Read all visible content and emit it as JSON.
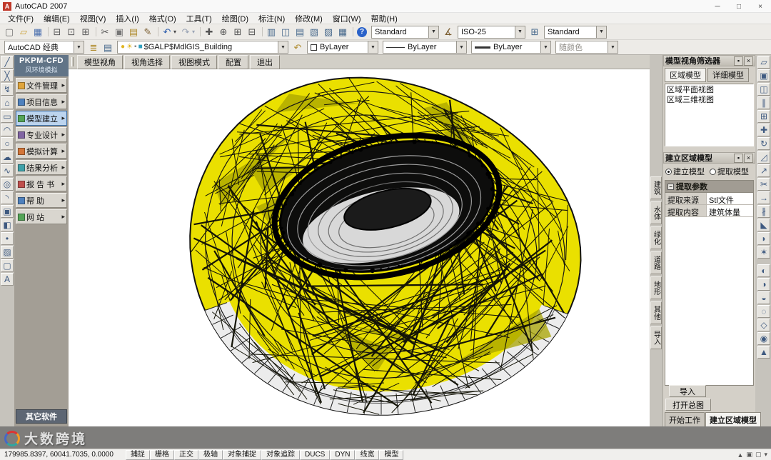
{
  "window": {
    "title": "AutoCAD 2007",
    "controls": [
      {
        "n": "minimize-button",
        "g": "─"
      },
      {
        "n": "maximize-button",
        "g": "□"
      },
      {
        "n": "close-button",
        "g": "×"
      }
    ]
  },
  "menu": {
    "items": [
      "文件(F)",
      "编辑(E)",
      "视图(V)",
      "插入(I)",
      "格式(O)",
      "工具(T)",
      "绘图(D)",
      "标注(N)",
      "修改(M)",
      "窗口(W)",
      "帮助(H)"
    ]
  },
  "icons": {
    "combo_arrow": "▼",
    "bulb": "●",
    "freeze": "☀",
    "lock": "▪",
    "chip": "■",
    "pin": "▪",
    "close": "×",
    "dim": "∡",
    "table": "⊞",
    "collapse": "−",
    "submenu_arrow": "▸"
  },
  "toolbar1": {
    "icons": [
      {
        "n": "qnew-icon",
        "g": "▢",
        "c": "#6b6b6b"
      },
      {
        "n": "open-icon",
        "g": "▱",
        "c": "#c89b2a"
      },
      {
        "n": "save-icon",
        "g": "▦",
        "c": "#4a6fae"
      },
      {
        "n": "sep",
        "cls": "sep"
      },
      {
        "n": "plot-icon",
        "g": "⊟",
        "c": "#5b5b5b"
      },
      {
        "n": "plot-preview-icon",
        "g": "⊡",
        "c": "#5b5b5b"
      },
      {
        "n": "publish-icon",
        "g": "⊞",
        "c": "#5b5b5b"
      },
      {
        "n": "sep",
        "cls": "sep"
      },
      {
        "n": "cut-icon",
        "g": "✂",
        "c": "#555555"
      },
      {
        "n": "copy-icon",
        "g": "▣",
        "c": "#777777"
      },
      {
        "n": "paste-icon",
        "g": "▤",
        "c": "#b08c2f"
      },
      {
        "n": "match-properties-icon",
        "g": "✎",
        "c": "#7a5c2e"
      },
      {
        "n": "sep",
        "cls": "sep"
      },
      {
        "n": "undo-icon",
        "g": "↶",
        "c": "#2f5fae"
      },
      {
        "n": "undo-arrow-icon",
        "g": "▾",
        "c": "#444444",
        "cls": "narrow"
      },
      {
        "n": "redo-icon",
        "g": "↷",
        "c": "#9aa4b5"
      },
      {
        "n": "redo-arrow-icon",
        "g": "▾",
        "c": "#9aa4b5",
        "cls": "narrow"
      },
      {
        "n": "sep",
        "cls": "sep"
      },
      {
        "n": "pan-icon",
        "g": "✚",
        "c": "#555555"
      },
      {
        "n": "zoom-realtime-icon",
        "g": "⊕",
        "c": "#555555"
      },
      {
        "n": "zoom-window-icon",
        "g": "⊞",
        "c": "#555555"
      },
      {
        "n": "zoom-previous-icon",
        "g": "⊟",
        "c": "#555555"
      },
      {
        "n": "sep",
        "cls": "sep"
      },
      {
        "n": "properties-icon",
        "g": "▥",
        "c": "#47698c"
      },
      {
        "n": "designcenter-icon",
        "g": "◫",
        "c": "#47698c"
      },
      {
        "n": "tool-palettes-icon",
        "g": "▤",
        "c": "#47698c"
      },
      {
        "n": "sheet-set-manager-icon",
        "g": "▧",
        "c": "#47698c"
      },
      {
        "n": "markup-icon",
        "g": "▨",
        "c": "#47698c"
      },
      {
        "n": "quickcalc-icon",
        "g": "▦",
        "c": "#47698c"
      },
      {
        "n": "sep",
        "cls": "sep"
      },
      {
        "n": "help-icon",
        "g": "?",
        "c": "#ffffff",
        "cls": "help"
      }
    ],
    "text_style": "Standard",
    "dim_style": "ISO-25",
    "table_style": "Standard"
  },
  "toolbar2": {
    "workspace": "AutoCAD 经典",
    "left_icons": [
      {
        "n": "layer-properties-icon",
        "g": "≣",
        "c": "#b08c2f"
      },
      {
        "n": "layer-states-icon",
        "g": "▤",
        "c": "#47698c"
      }
    ],
    "layer_name": "$GALP$MdlGIS_Building",
    "right_icons": [
      {
        "n": "layer-previous-icon",
        "g": "↶",
        "c": "#b08c2f"
      }
    ],
    "color": "ByLayer",
    "linetype": "ByLayer",
    "lineweight": "ByLayer",
    "plot_style": "随颜色"
  },
  "draw_toolbar": {
    "icons": [
      {
        "n": "line-icon",
        "g": "╱"
      },
      {
        "n": "construction-line-icon",
        "g": "╳"
      },
      {
        "n": "polyline-icon",
        "g": "↯"
      },
      {
        "n": "polygon-icon",
        "g": "⌂"
      },
      {
        "n": "rectangle-icon",
        "g": "▭"
      },
      {
        "n": "arc-icon",
        "g": "◠"
      },
      {
        "n": "circle-icon",
        "g": "○"
      },
      {
        "n": "revcloud-icon",
        "g": "☁"
      },
      {
        "n": "spline-icon",
        "g": "∿"
      },
      {
        "n": "ellipse-icon",
        "g": "◎"
      },
      {
        "n": "ellipse-arc-icon",
        "g": "◝"
      },
      {
        "n": "insert-block-icon",
        "g": "▣"
      },
      {
        "n": "make-block-icon",
        "g": "◧"
      },
      {
        "n": "point-icon",
        "g": "•"
      },
      {
        "n": "hatch-icon",
        "g": "▨"
      },
      {
        "n": "region-icon",
        "g": "▢"
      },
      {
        "n": "mtext-icon",
        "g": "A"
      }
    ]
  },
  "modify_toolbar": {
    "icons": [
      {
        "n": "erase-icon",
        "g": "▱"
      },
      {
        "n": "copy-object-icon",
        "g": "▣"
      },
      {
        "n": "mirror-icon",
        "g": "◫"
      },
      {
        "n": "offset-icon",
        "g": "∥"
      },
      {
        "n": "array-icon",
        "g": "⊞"
      },
      {
        "n": "move-icon",
        "g": "✚"
      },
      {
        "n": "rotate-icon",
        "g": "↻"
      },
      {
        "n": "scale-icon",
        "g": "◿"
      },
      {
        "n": "stretch-icon",
        "g": "↗"
      },
      {
        "n": "trim-icon",
        "g": "✂"
      },
      {
        "n": "extend-icon",
        "g": "→"
      },
      {
        "n": "break-icon",
        "g": "∦"
      },
      {
        "n": "chamfer-icon",
        "g": "◣"
      },
      {
        "n": "fillet-icon",
        "g": "◗"
      },
      {
        "n": "explode-icon",
        "g": "✶"
      },
      {
        "n": "sep",
        "cls": "sep"
      },
      {
        "n": "union-icon",
        "g": "◐"
      },
      {
        "n": "subtract-icon",
        "g": "◑"
      },
      {
        "n": "intersect-icon",
        "g": "◒"
      },
      {
        "n": "orbit-icon",
        "g": "◌"
      },
      {
        "n": "align-icon",
        "g": "◇"
      },
      {
        "n": "shade-icon",
        "g": "◉"
      },
      {
        "n": "render-icon",
        "g": "▲"
      }
    ]
  },
  "plugin": {
    "title": "PKPM-CFD",
    "subtitle": "风环境模拟",
    "items": [
      {
        "n": "pkpm-item-file-manage",
        "label": "文件管理",
        "c": "#e0a53c"
      },
      {
        "n": "pkpm-item-project-info",
        "label": "项目信息",
        "c": "#4f81bd"
      },
      {
        "n": "pkpm-item-model-build",
        "label": "模型建立",
        "c": "#54a457",
        "active": true
      },
      {
        "n": "pkpm-item-pro-design",
        "label": "专业设计",
        "c": "#8064a2"
      },
      {
        "n": "pkpm-item-simulation",
        "label": "模拟计算",
        "c": "#d2763a"
      },
      {
        "n": "pkpm-item-result-analysis",
        "label": "结果分析",
        "c": "#3fa0a8"
      },
      {
        "n": "pkpm-item-report",
        "label": "报 告 书",
        "c": "#c0504d"
      },
      {
        "n": "pkpm-item-help",
        "label": "帮  助",
        "c": "#4f81bd"
      },
      {
        "n": "pkpm-item-website",
        "label": "网  站",
        "c": "#54a457"
      }
    ],
    "other_button": "其它软件"
  },
  "viewport": {
    "toolbar": [
      {
        "n": "model-view-button",
        "label": "模型视角"
      },
      {
        "n": "view-select-button",
        "label": "视角选择"
      },
      {
        "n": "view-mode-button",
        "label": "视图模式"
      },
      {
        "n": "config-button",
        "label": "配置"
      },
      {
        "n": "exit-button",
        "label": "退出"
      }
    ],
    "colors": {
      "bg": "#ffffff",
      "mesh": "#141407",
      "shell_yellow": "#eae000",
      "shell_olive": "#a8a400",
      "opening_dark": "#0d0d0c",
      "stand_gray": "#d8d8d8",
      "base_gray": "#ececec"
    }
  },
  "side_tabs": {
    "items": [
      {
        "n": "category-tab-building",
        "label": "建筑"
      },
      {
        "n": "category-tab-water",
        "label": "水体"
      },
      {
        "n": "category-tab-green",
        "label": "绿化"
      },
      {
        "n": "category-tab-road",
        "label": "道路"
      },
      {
        "n": "category-tab-terrain",
        "label": "地形"
      },
      {
        "n": "category-tab-other",
        "label": "其他"
      },
      {
        "n": "category-tab-import",
        "label": "导入"
      }
    ]
  },
  "right_panel": {
    "filter": {
      "title": "模型视角筛选器",
      "tabs": [
        {
          "n": "tab-region-model",
          "label": "区域模型",
          "active": true
        },
        {
          "n": "tab-detail-model",
          "label": "详细模型"
        }
      ],
      "views": [
        "区域平面视图",
        "区域三维视图"
      ]
    },
    "builder": {
      "title": "建立区域模型",
      "radios": [
        {
          "n": "radio-build-model",
          "label": "建立模型",
          "active": true
        },
        {
          "n": "radio-extract-model",
          "label": "提取模型"
        }
      ],
      "group_header": "提取参数",
      "params": [
        {
          "label": "提取来源",
          "value": "Stl文件"
        },
        {
          "label": "提取内容",
          "value": "建筑体量"
        }
      ],
      "import_button": "导入",
      "open_button": "打开总图",
      "tabs": [
        {
          "n": "tab-start-work",
          "label": "开始工作"
        },
        {
          "n": "tab-build-region",
          "label": "建立区域模型",
          "active": true
        }
      ]
    }
  },
  "status": {
    "coords": "179985.8397, 60041.7035, 0.0000",
    "toggles": [
      {
        "n": "snap-toggle",
        "label": "捕捉"
      },
      {
        "n": "grid-toggle",
        "label": "栅格"
      },
      {
        "n": "ortho-toggle",
        "label": "正交"
      },
      {
        "n": "polar-toggle",
        "label": "极轴"
      },
      {
        "n": "osnap-toggle",
        "label": "对象捕捉"
      },
      {
        "n": "otrack-toggle",
        "label": "对象追踪"
      },
      {
        "n": "ducs-toggle",
        "label": "DUCS"
      },
      {
        "n": "dyn-toggle",
        "label": "DYN"
      },
      {
        "n": "lwt-toggle",
        "label": "线宽"
      },
      {
        "n": "model-toggle",
        "label": "模型"
      }
    ],
    "right_icons": [
      {
        "n": "annotation-scale-icon",
        "g": "▲"
      },
      {
        "n": "status-tray-icon",
        "g": "▣"
      },
      {
        "n": "clean-screen-icon",
        "g": "▢"
      },
      {
        "n": "tray-chevron-icon",
        "g": "▾"
      }
    ]
  },
  "watermark": {
    "text": "大数跨境"
  }
}
